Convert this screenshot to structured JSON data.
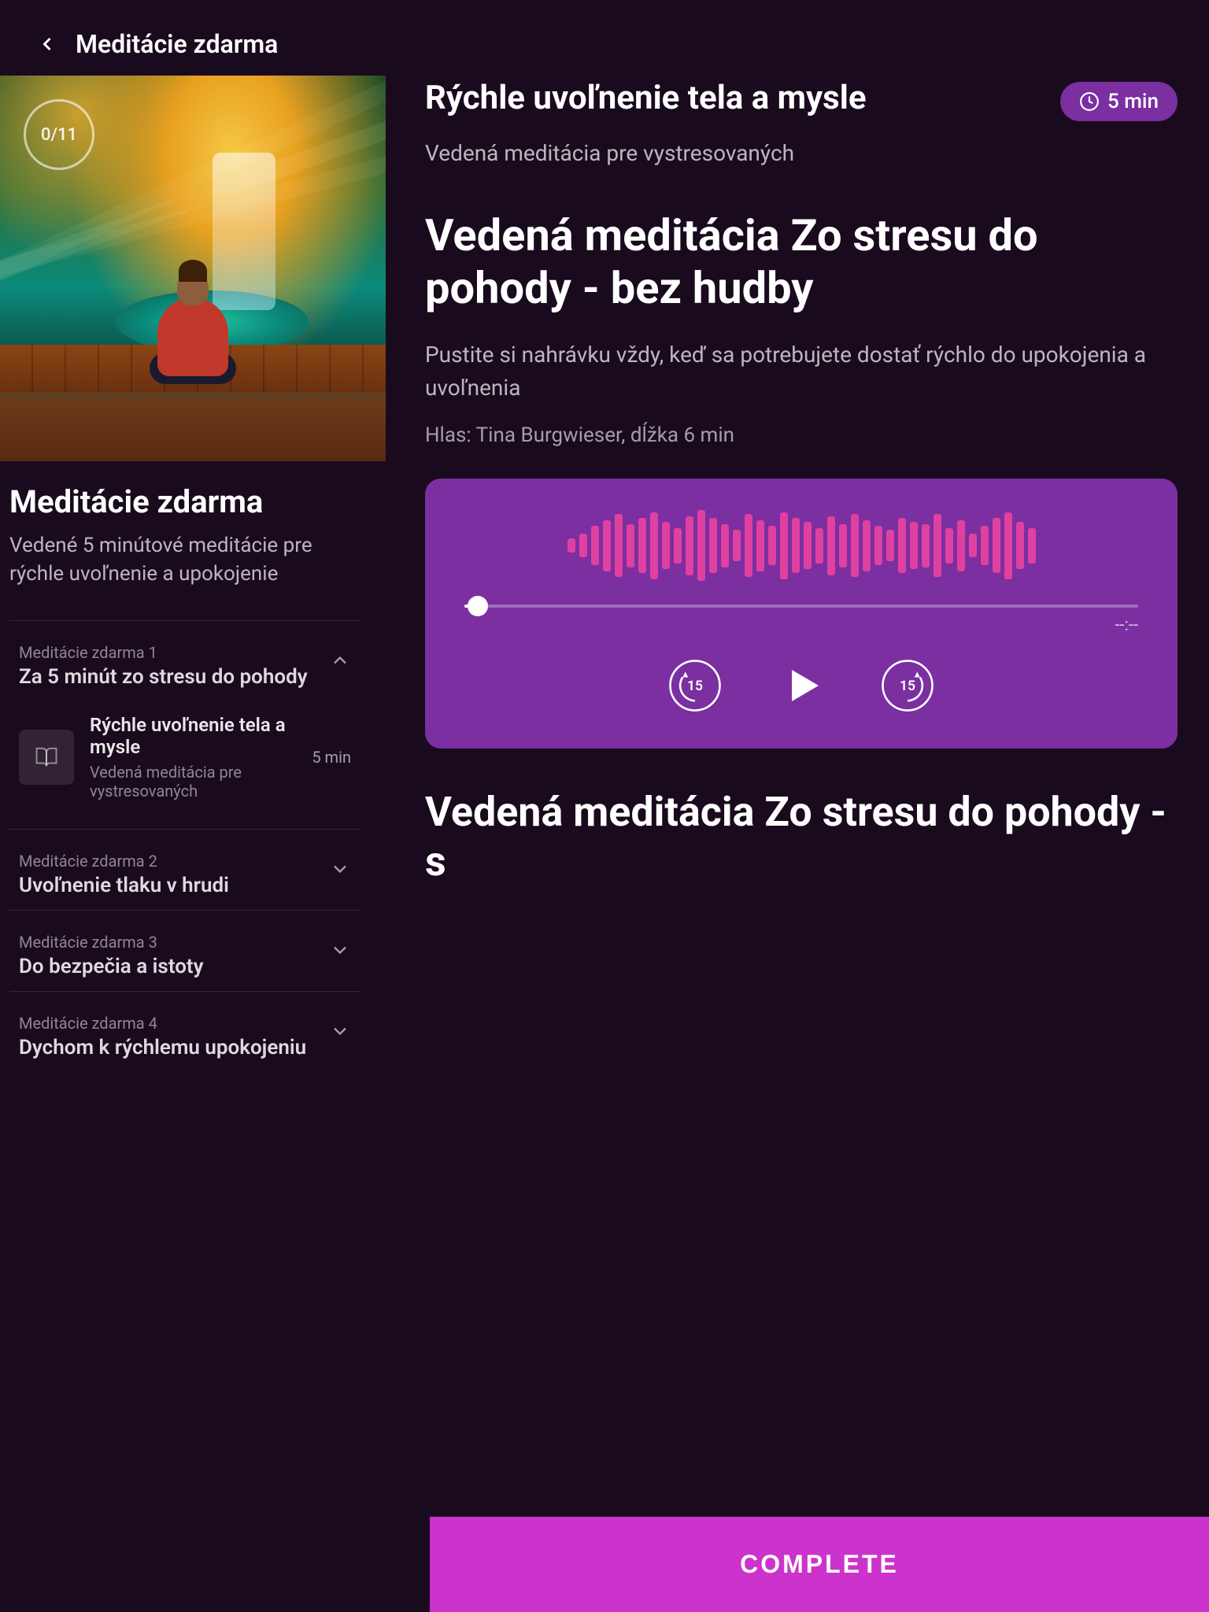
{
  "header": {
    "back_label": "Meditácie zdarma",
    "title": "Meditácie zdarma"
  },
  "hero": {
    "counter": "0/11"
  },
  "left": {
    "collection_title": "Meditácie zdarma",
    "collection_desc": "Vedené 5 minútové meditácie pre rýchle uvoľnenie a upokojenie",
    "lessons": [
      {
        "label": "Meditácie zdarma 1",
        "title": "Za 5 minút zo stresu do pohody",
        "expanded": true,
        "items": [
          {
            "thumb_icon": "book",
            "title": "Rýchle uvoľnenie tela a mysle",
            "subtitle": "Vedená meditácia pre vystresovaných",
            "duration": "5 min"
          }
        ]
      },
      {
        "label": "Meditácie zdarma 2",
        "title": "Uvoľnenie tlaku v hrudi",
        "expanded": false,
        "items": []
      },
      {
        "label": "Meditácie zdarma 3",
        "title": "Do bezpečia a istoty",
        "expanded": false,
        "items": []
      },
      {
        "label": "Meditácie zdarma 4",
        "title": "Dychom k rýchlemu upokojeniu",
        "expanded": false,
        "items": []
      }
    ]
  },
  "right": {
    "article_title": "Rýchle uvoľnenie tela a mysle",
    "time_label": "5 min",
    "article_subtitle": "Vedená meditácia pre vystresovaných",
    "section1_title": "Vedená meditácia Zo stresu do pohody - bez hudby",
    "section1_desc": "Pustite si nahrávku vždy, keď sa potrebujete dostať rýchlo do upokojenia a uvoľnenia",
    "section1_meta": "Hlas: Tina Burgwieser, dĺžka 6 min",
    "player": {
      "time_remaining": "--:--",
      "progress_percent": 2
    },
    "section2_title": "Vedená meditácia Zo stresu do pohody - s",
    "complete_label": "COMPLETE"
  },
  "waveform_bars": [
    18,
    30,
    50,
    65,
    80,
    55,
    70,
    85,
    60,
    45,
    75,
    90,
    70,
    55,
    40,
    80,
    65,
    50,
    85,
    70,
    60,
    45,
    75,
    55,
    80,
    65,
    50,
    40,
    70,
    60,
    55,
    80,
    45,
    65,
    30,
    50,
    70,
    85,
    60,
    45
  ],
  "icons": {
    "back": "chevron-left",
    "clock": "clock",
    "book": "book-open",
    "chevron_down": "chevron-down",
    "chevron_up": "chevron-up",
    "rewind15": "rewind-15",
    "play": "play",
    "forward15": "forward-15"
  },
  "colors": {
    "background": "#1a0a1e",
    "accent": "#cc33cc",
    "player_bg": "#7b2fa0",
    "time_badge_bg": "#7b2fa0",
    "waveform_bar": "#e040a0"
  }
}
